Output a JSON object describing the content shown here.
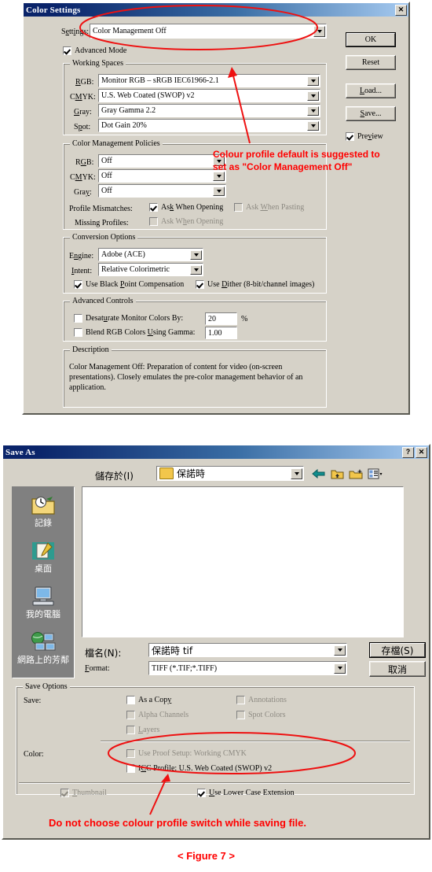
{
  "figure_caption": "< Figure 7 >",
  "color_settings": {
    "title": "Color Settings",
    "close_label": "✕",
    "settings_label": "Settings:",
    "settings_value": "Color Management Off",
    "advanced_mode": "Advanced Mode",
    "working_spaces": {
      "caption": "Working Spaces",
      "rows": [
        {
          "label": "RGB:",
          "value": "Monitor RGB – sRGB IEC61966-2.1"
        },
        {
          "label": "CMYK:",
          "value": "U.S. Web Coated (SWOP) v2"
        },
        {
          "label": "Gray:",
          "value": "Gray Gamma 2.2"
        },
        {
          "label": "Spot:",
          "value": "Dot Gain 20%"
        }
      ]
    },
    "policies": {
      "caption": "Color Management Policies",
      "rows": [
        {
          "label": "RGB:",
          "value": "Off"
        },
        {
          "label": "CMYK:",
          "value": "Off"
        },
        {
          "label": "Gray:",
          "value": "Off"
        }
      ],
      "profile_mismatches_label": "Profile Mismatches:",
      "mismatch_ask_opening": "Ask When Opening",
      "mismatch_ask_pasting": "Ask When Pasting",
      "missing_profiles_label": "Missing Profiles:",
      "missing_ask_opening": "Ask When Opening"
    },
    "conversion": {
      "caption": "Conversion Options",
      "engine_label": "Engine:",
      "engine_value": "Adobe (ACE)",
      "intent_label": "Intent:",
      "intent_value": "Relative Colorimetric",
      "black_point": "Use Black Point Compensation",
      "dither": "Use Dither (8-bit/channel images)"
    },
    "advanced": {
      "caption": "Advanced Controls",
      "desaturate_label": "Desaturate Monitor Colors By:",
      "desaturate_value": "20",
      "percent": "%",
      "blend_label": "Blend RGB Colors Using Gamma:",
      "blend_value": "1.00"
    },
    "description": {
      "caption": "Description",
      "text": "Color Management Off:  Preparation of content for video (on-screen presentations). Closely emulates the pre-color management behavior of an application."
    },
    "buttons": {
      "ok": "OK",
      "reset": "Reset",
      "load": "Load...",
      "save": "Save...",
      "preview": "Preview"
    },
    "annotation": {
      "line1": "Colour profile default is suggested to",
      "line2": "set as \"Color Management Off\""
    }
  },
  "save_as": {
    "title": "Save As",
    "help_label": "?",
    "close_label": "✕",
    "save_in_label": "儲存於(I)",
    "save_in_value": "保諾時",
    "sidebar": [
      {
        "label": "記錄",
        "icon": "history-icon"
      },
      {
        "label": "桌面",
        "icon": "desktop-icon"
      },
      {
        "label": "我的電腦",
        "icon": "my-computer-icon"
      },
      {
        "label": "網路上的芳鄰",
        "icon": "network-neighborhood-icon"
      }
    ],
    "filename_label": "檔名(N):",
    "filename_value": "保諾時 tif",
    "format_label": "Format:",
    "format_value": "TIFF (*.TIF;*.TIFF)",
    "save_button": "存檔(S)",
    "cancel_button": "取消",
    "save_options": {
      "caption": "Save Options",
      "save_label": "Save:",
      "as_a_copy": "As a Copy",
      "alpha_channels": "Alpha Channels",
      "layers": "Layers",
      "annotations": "Annotations",
      "spot_colors": "Spot Colors",
      "color_label": "Color:",
      "use_proof_setup": "Use Proof Setup:  Working CMYK",
      "icc_profile": "ICC Profile:  U.S. Web Coated (SWOP) v2",
      "thumbnail": "Thumbnail",
      "lower_case_ext": "Use Lower Case Extension"
    },
    "annotation": "Do not choose colour profile switch while saving file."
  }
}
